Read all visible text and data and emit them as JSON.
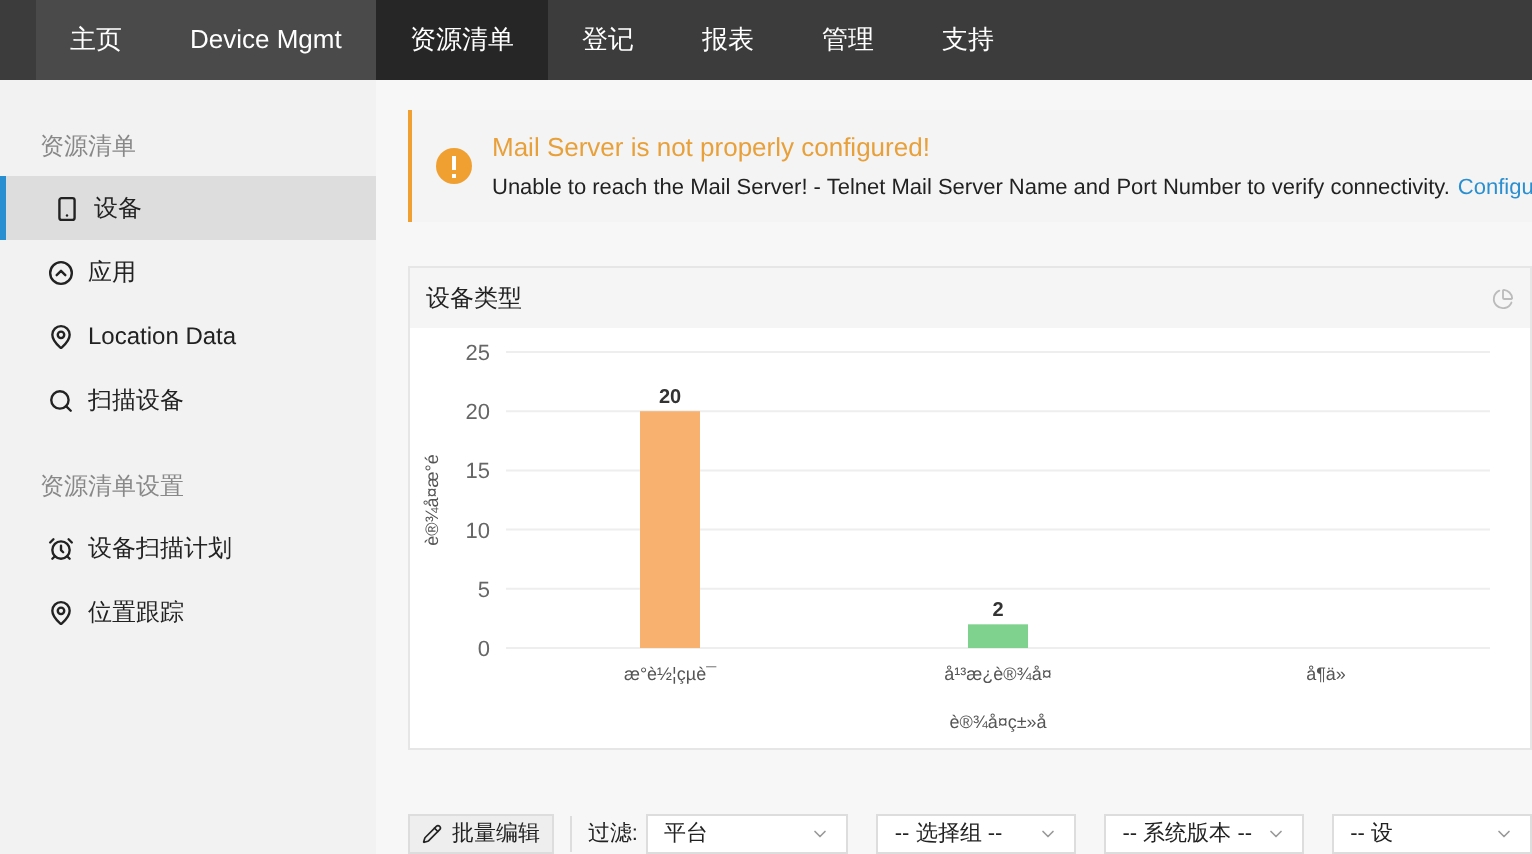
{
  "nav": {
    "tabs": [
      {
        "label": "主页",
        "selected": false
      },
      {
        "label": "Device Mgmt",
        "selected": false
      },
      {
        "label": "资源清单",
        "selected": true
      },
      {
        "label": "登记",
        "selected": false
      },
      {
        "label": "报表",
        "selected": false
      },
      {
        "label": "管理",
        "selected": false
      },
      {
        "label": "支持",
        "selected": false
      }
    ]
  },
  "sidebar": {
    "sections": [
      {
        "title": "资源清单",
        "items": [
          {
            "label": "设备",
            "selected": true
          },
          {
            "label": "应用",
            "selected": false
          },
          {
            "label": "Location Data",
            "selected": false
          },
          {
            "label": "扫描设备",
            "selected": false
          }
        ]
      },
      {
        "title": "资源清单设置",
        "items": [
          {
            "label": "设备扫描计划",
            "selected": false
          },
          {
            "label": "位置跟踪",
            "selected": false
          }
        ]
      }
    ]
  },
  "alert": {
    "title": "Mail Server is not properly configured!",
    "message": "Unable to reach the Mail Server! - Telnet Mail Server Name and Port Number to verify connectivity.",
    "link": "Configu"
  },
  "chart_panel": {
    "title": "设备类型",
    "chart_data": {
      "type": "bar",
      "xlabel": "è®¾å¤ç±»å",
      "ylabel": "è®¾å¤æ°é",
      "categories": [
        "æ°è½¦çµè¯",
        "å¹³æ¿è®¾å¤",
        "å¶ä»"
      ],
      "values": [
        20,
        2,
        0
      ],
      "colors": [
        "#f8b16f",
        "#7fd28e",
        null
      ],
      "ylim": [
        0,
        25
      ],
      "yticks": [
        0,
        5,
        10,
        15,
        20,
        25
      ],
      "grid": true,
      "value_labels": [
        "20",
        "2",
        null
      ]
    }
  },
  "toolbar": {
    "bulk_edit": "批量编辑",
    "filter_label": "过滤:",
    "selects": [
      {
        "value": "平台"
      },
      {
        "value": "-- 选择组 --"
      },
      {
        "value": "-- 系统版本 --"
      },
      {
        "value": "-- 设"
      }
    ]
  }
}
